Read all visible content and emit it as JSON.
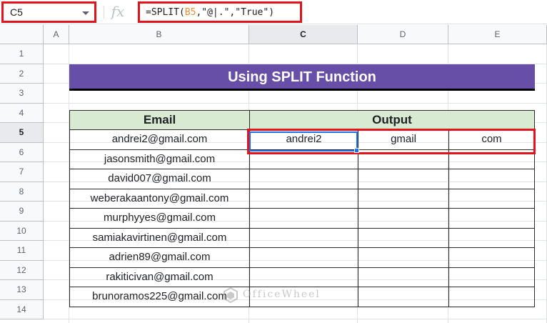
{
  "formula_bar": {
    "name_box": "C5",
    "fx_icon": "fx-icon",
    "formula_prefix": "=SPLIT(",
    "formula_ref": "B5",
    "formula_suffix": ",\"@|.\",\"True\")"
  },
  "columns": [
    "A",
    "B",
    "C",
    "D",
    "E"
  ],
  "rows": [
    "1",
    "2",
    "3",
    "4",
    "5",
    "6",
    "7",
    "8",
    "9",
    "10",
    "11",
    "12",
    "13",
    "14"
  ],
  "selected": {
    "column": "C",
    "row": "5"
  },
  "sheet": {
    "title": "Using SPLIT Function",
    "headers": {
      "email": "Email",
      "output": "Output"
    },
    "emails": [
      "andrei2@gmail.com",
      "jasonsmith@gmail.com",
      "david007@gmail.com",
      "weberakaantony@gmail.com",
      "murphyyes@gmail.com",
      "samiakavirtinen@gmail.com",
      "adrien89@gmail.com",
      "rakiticivan@gmail.com",
      "brunoramos225@gmail.com"
    ],
    "output_row5": [
      "andrei2",
      "gmail",
      "com"
    ]
  },
  "watermark": {
    "text": "OfficeWheel"
  },
  "colors": {
    "title_bg": "#674ea7",
    "header_bg": "#d9ead3",
    "highlight_red": "#e2131b",
    "selection_blue": "#1a73e8",
    "reference_orange": "#e69138"
  }
}
